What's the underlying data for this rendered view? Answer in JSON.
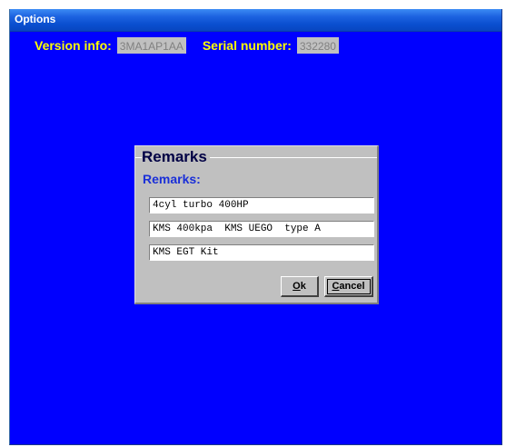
{
  "window": {
    "title": "Options"
  },
  "info": {
    "version_label": "Version info:",
    "version_value": "3MA1AP1AA",
    "serial_label": "Serial number:",
    "serial_value": "332280"
  },
  "dialog": {
    "title": "Remarks",
    "subtitle": "Remarks:",
    "remarks": [
      "4cyl turbo 400HP",
      "KMS 400kpa  KMS UEGO  type A",
      "KMS EGT Kit"
    ],
    "ok_accel": "O",
    "ok_rest": "k",
    "cancel_accel": "C",
    "cancel_rest": "ancel"
  },
  "colors": {
    "background": "#0000ff",
    "label_yellow": "#ffff00",
    "subtitle_blue": "#1a2fd8",
    "dialog_gray": "#c0c0c0"
  }
}
